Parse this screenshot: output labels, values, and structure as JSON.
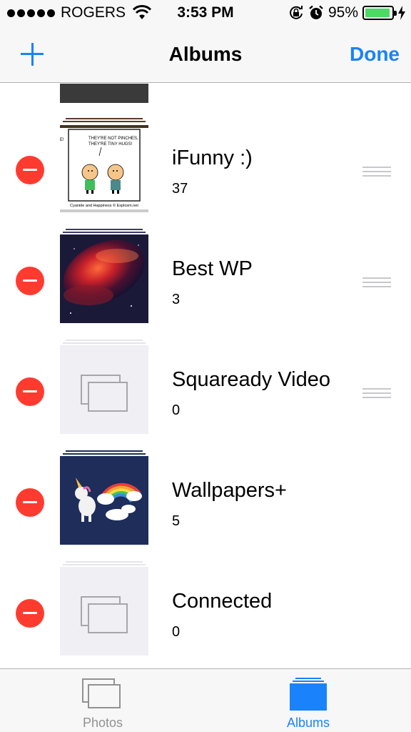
{
  "status_bar": {
    "carrier": "ROGERS",
    "time": "3:53 PM",
    "battery_percent": "95%",
    "battery_level": 0.95,
    "icons": [
      "signal-dots-icon",
      "wifi-icon",
      "rotation-lock-icon",
      "alarm-icon",
      "battery-icon",
      "charging-bolt-icon"
    ]
  },
  "nav": {
    "title": "Albums",
    "done_label": "Done",
    "accent_color": "#1a82fb"
  },
  "albums": [
    {
      "name": "iFunny :)",
      "count": "37",
      "thumbnail": "comic",
      "reorderable": true
    },
    {
      "name": "Best WP",
      "count": "3",
      "thumbnail": "nebula",
      "reorderable": true
    },
    {
      "name": "Squaready Video",
      "count": "0",
      "thumbnail": "empty",
      "reorderable": true
    },
    {
      "name": "Wallpapers+",
      "count": "5",
      "thumbnail": "unicorn",
      "reorderable": false
    },
    {
      "name": "Connected",
      "count": "0",
      "thumbnail": "empty",
      "reorderable": false
    }
  ],
  "comic": {
    "speech": "THEY'RE NOT PINCHES, THEY'RE TINY HUGS!",
    "credit": "Cyanide and Happiness © Explosm.net",
    "edge_text": "E!"
  },
  "tabs": [
    {
      "label": "Photos",
      "active": false
    },
    {
      "label": "Albums",
      "active": true
    }
  ],
  "colors": {
    "delete": "#ff3b30",
    "battery": "#4cd964",
    "inactive_tab": "#929292"
  }
}
